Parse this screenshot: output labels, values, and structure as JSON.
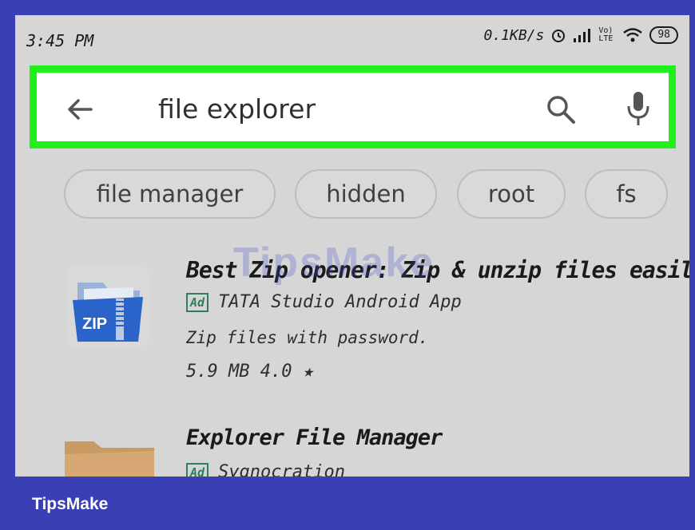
{
  "status": {
    "time": "3:45 PM",
    "network_speed": "0.1KB/s",
    "battery": "98",
    "volte": "Vo) LTE"
  },
  "search": {
    "query": "file explorer"
  },
  "chips": [
    "file manager",
    "hidden",
    "root",
    "fs"
  ],
  "results": [
    {
      "title": "Best Zip opener: Zip & unzip files easily",
      "ad_badge": "Ad",
      "developer": "TATA Studio Android App",
      "description": "Zip files with password.",
      "meta": "5.9 MB 4.0 ★",
      "icon_label": "ZIP"
    },
    {
      "title": "Explorer File Manager",
      "ad_badge": "Ad",
      "developer": "Sygnocration"
    }
  ],
  "watermark": "TipsMake",
  "footer": {
    "brand": "TipsMake"
  },
  "colors": {
    "frame": "#3a3fb4",
    "highlight": "#1ff01a",
    "screen_bg": "#d6d6d6",
    "zip_blue": "#2a63c9"
  }
}
